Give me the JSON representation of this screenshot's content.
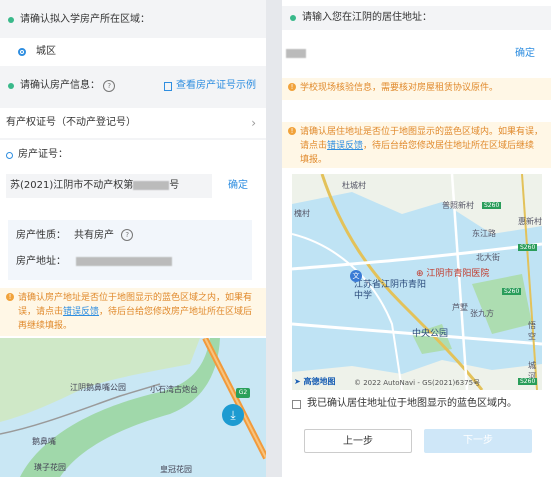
{
  "left": {
    "district_label": "请确认拟入学房产所在区域：",
    "district_option": "城区",
    "property_info_label": "请确认房产信息：",
    "help_glyph": "?",
    "view_example_link": "查看房产证号示例",
    "cert_type": "有产权证号（不动产登记号）",
    "cert_no_label": "房产证号：",
    "cert_no_prefix": "苏(2021)江阴市不动产权第",
    "cert_no_suffix": "号",
    "confirm": "确定",
    "nature_label": "房产性质：",
    "nature_value": "共有房产",
    "address_label": "房产地址：",
    "warning": {
      "text_before": "请确认房产地址是否位于地图显示的蓝色区域之内，如果有误，请点击",
      "link": "错误反馈",
      "text_after": "，待后台给您修改房产地址所在区域后再继续填报。"
    },
    "map_labels": [
      "江阴鹅鼻嘴公园",
      "小石湾古炮台",
      "鹅鼻嘴",
      "璜子花园",
      "皇冠花园"
    ],
    "shield": "G2"
  },
  "right": {
    "address_prompt": "请输入您在江阴的居住地址：",
    "confirm": "确定",
    "notice": "学校现场核验信息，需要核对房屋租赁协议原件。",
    "warning": {
      "text_before": "请确认居住地址是否位于地图显示的蓝色区域内。如果有误，请点击",
      "link": "错误反馈",
      "text_after": "，待后台给您修改居住地址所在区域后继续填报。"
    },
    "map_labels": [
      "杜城村",
      "普照新村",
      "惠新村",
      "东江路",
      "北大街",
      "槐村",
      "江阴市青阳医院",
      "江苏省江阴市青阳中学",
      "中央公园",
      "芦墅",
      "张九方",
      "悟空",
      "城河"
    ],
    "road_shields": [
      "S260",
      "S260",
      "S260",
      "S260"
    ],
    "map_logo": "高德地图",
    "map_copyright": "© 2022 AutoNavi - GS(2021)6375号",
    "checkbox_label": "我已确认居住地址位于地图显示的蓝色区域内。",
    "prev_button": "上一步",
    "next_button": "下一步"
  },
  "colors": {
    "accent_blue": "#2f8ee0",
    "dot_green": "#39b98a",
    "warning_orange": "#e0892b",
    "area_blue": "#bfe3f4"
  }
}
